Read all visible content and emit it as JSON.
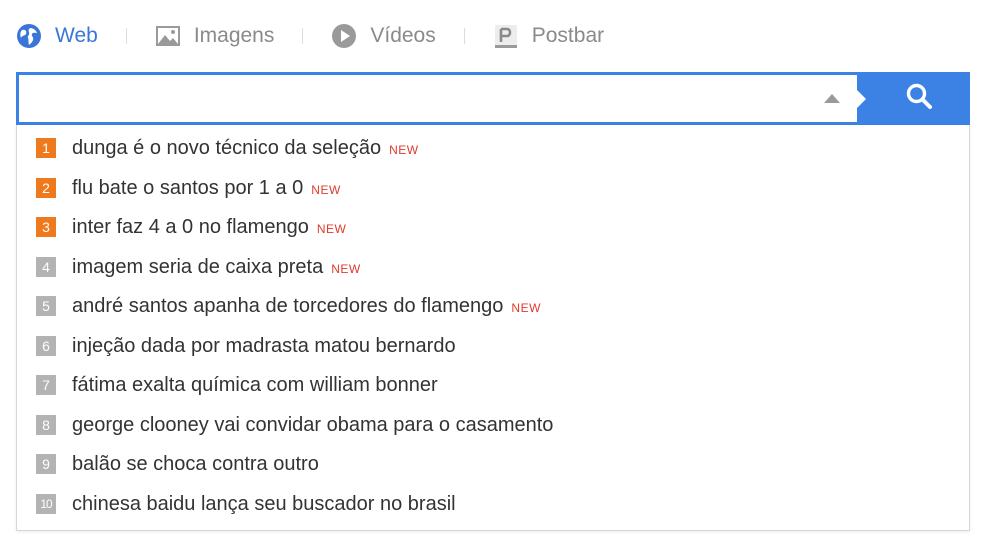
{
  "tabs": [
    {
      "label": "Web",
      "icon": "globe-icon",
      "active": true
    },
    {
      "label": "Imagens",
      "icon": "image-icon",
      "active": false
    },
    {
      "label": "Vídeos",
      "icon": "play-icon",
      "active": false
    },
    {
      "label": "Postbar",
      "icon": "postbar-icon",
      "active": false
    }
  ],
  "search": {
    "value": "",
    "placeholder": "",
    "button_icon": "search-icon"
  },
  "colors": {
    "accent": "#3b82e4",
    "active_tab": "#3a76d8",
    "hot_rank": "#ef7a1d",
    "cold_rank": "#b3b3b3",
    "new_badge": "#e03a2e"
  },
  "suggestions": [
    {
      "rank": "1",
      "text": "dunga é o novo técnico da seleção",
      "badge": "NEW"
    },
    {
      "rank": "2",
      "text": "flu bate o santos por 1 a 0",
      "badge": "NEW"
    },
    {
      "rank": "3",
      "text": "inter faz 4 a 0 no flamengo",
      "badge": "NEW"
    },
    {
      "rank": "4",
      "text": "imagem seria de caixa preta",
      "badge": "NEW"
    },
    {
      "rank": "5",
      "text": "andré santos apanha de torcedores do flamengo",
      "badge": "NEW"
    },
    {
      "rank": "6",
      "text": "injeção dada por madrasta matou bernardo",
      "badge": ""
    },
    {
      "rank": "7",
      "text": "fátima exalta química com william bonner",
      "badge": ""
    },
    {
      "rank": "8",
      "text": "george clooney vai convidar obama para o casamento",
      "badge": ""
    },
    {
      "rank": "9",
      "text": "balão se choca contra outro",
      "badge": ""
    },
    {
      "rank": "10",
      "text": "chinesa baidu lança seu buscador no brasil",
      "badge": ""
    }
  ]
}
